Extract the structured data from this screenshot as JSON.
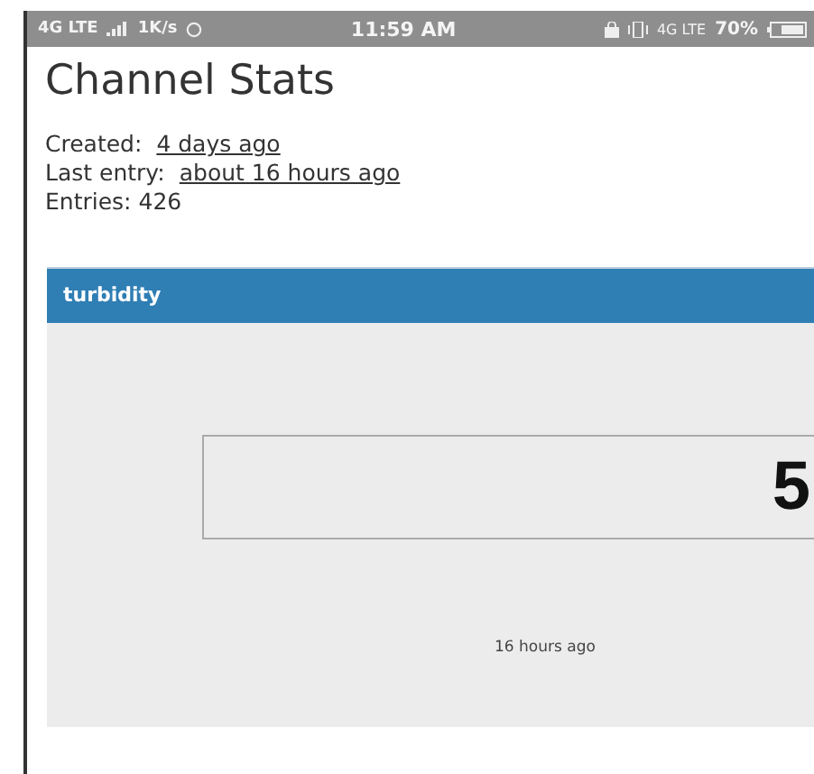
{
  "status_bar": {
    "network": "4G LTE",
    "speed": "1K/s",
    "time": "11:59 AM",
    "network_2": "4G LTE",
    "battery": "70%"
  },
  "title": "Channel Stats",
  "stats": [
    {
      "label": "Created:",
      "value": "4 days ago"
    },
    {
      "label": "Last entry:",
      "value": "about 16 hours ago"
    },
    {
      "label": "Entries:",
      "value": "426",
      "kind": "plain"
    }
  ],
  "widget": {
    "title": "turbidity",
    "value": "5",
    "updated": "16 hours ago"
  }
}
